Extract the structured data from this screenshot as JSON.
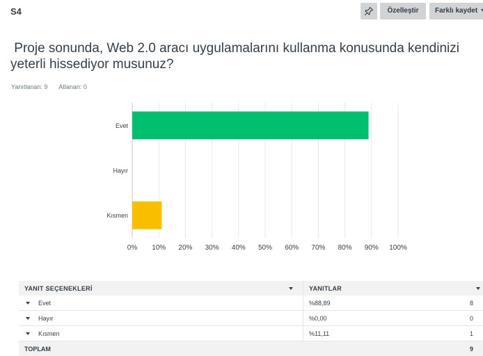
{
  "header": {
    "question_number": "S4",
    "pin_icon": "pin-icon",
    "customize_label": "Özelleştir",
    "save_as_label": "Farklı kaydet"
  },
  "question": {
    "text": " Proje sonunda, Web 2.0 aracı uygulamalarını kullanma konusunda kendinizi\nyeterli hissediyor musunuz?",
    "answered": "Yanıtlanan: 9",
    "skipped": "Atlanan: 0"
  },
  "chart_data": {
    "type": "bar",
    "orientation": "horizontal",
    "categories": [
      "Evet",
      "Hayır",
      "Kısmen"
    ],
    "values": [
      88.89,
      0,
      11.11
    ],
    "colors": [
      "#00bf6f",
      "#00bf6f",
      "#f9be00"
    ],
    "xlim": [
      0,
      100
    ],
    "xticks": [
      "0%",
      "10%",
      "20%",
      "30%",
      "40%",
      "50%",
      "60%",
      "70%",
      "80%",
      "90%",
      "100%"
    ],
    "grid": true
  },
  "table": {
    "col_choices": "YANIT SEÇENEKLERİ",
    "col_responses": "YANITLAR",
    "rows": [
      {
        "label": "Evet",
        "percent": "%88,89",
        "count": "8"
      },
      {
        "label": "Hayır",
        "percent": "%0,00",
        "count": "0"
      },
      {
        "label": "Kısmen",
        "percent": "%11,11",
        "count": "1"
      }
    ],
    "total_label": "TOPLAM",
    "total_count": "9"
  }
}
